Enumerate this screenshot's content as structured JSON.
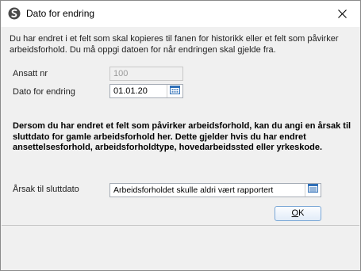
{
  "window": {
    "title": "Dato for endring",
    "app_icon": "app-logo-icon",
    "close_icon": "close-icon"
  },
  "intro": {
    "text": "Du har endret i et felt som skal kopieres til fanen for historikk eller et felt som påvirker arbeidsforhold. Du må oppgi datoen for når endringen skal gjelde fra."
  },
  "form": {
    "employee_no": {
      "label": "Ansatt nr",
      "value": "100"
    },
    "change_date": {
      "label": "Dato for endring",
      "value": "01.01.20",
      "icon": "calendar-icon"
    },
    "end_reason": {
      "label": "Årsak til sluttdato",
      "value": "Arbeidsforholdet skulle aldri vært rapportert",
      "icon": "list-icon"
    }
  },
  "warning": {
    "text": "Dersom du har endret et felt som påvirker arbeidsforhold, kan du angi en årsak til sluttdato for gamle arbeidsforhold her. Dette gjelder hvis du har endret ansettelsesforhold, arbeidsforholdtype, hovedarbeidssted eller yrkeskode."
  },
  "buttons": {
    "ok_mnemonic": "O",
    "ok_rest": "K"
  },
  "colors": {
    "accent": "#3a78c2",
    "border": "#a5acb5"
  }
}
